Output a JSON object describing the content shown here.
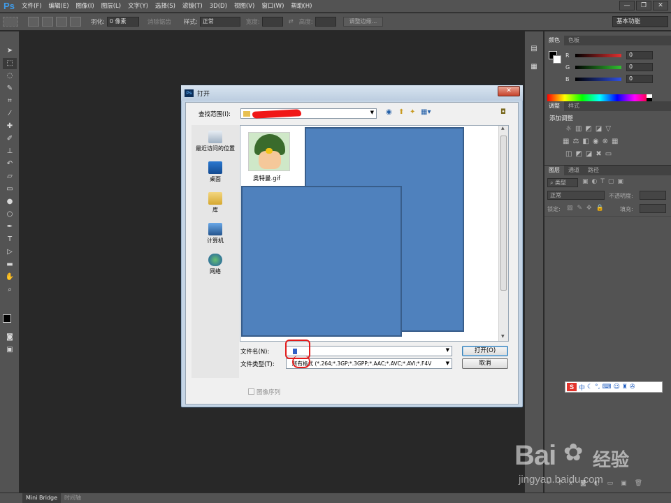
{
  "app": {
    "logo": "Ps",
    "menu": [
      "文件(F)",
      "编辑(E)",
      "图像(I)",
      "图层(L)",
      "文字(Y)",
      "选择(S)",
      "滤镜(T)",
      "3D(D)",
      "视图(V)",
      "窗口(W)",
      "帮助(H)"
    ],
    "window_controls": [
      "—",
      "❐",
      "✕"
    ]
  },
  "options": {
    "feather_label": "羽化:",
    "feather_value": "0 像素",
    "antialias_label": "消除锯齿",
    "style_label": "样式:",
    "style_value": "正常",
    "width_label": "宽度:",
    "height_label": "高度:",
    "refine_edge": "调整边缘...",
    "workspace": "基本功能"
  },
  "panels": {
    "color_tabs": [
      "颜色",
      "色板"
    ],
    "channels": [
      {
        "label": "R",
        "value": "0",
        "color": "#e03030"
      },
      {
        "label": "G",
        "value": "0",
        "color": "#30c030"
      },
      {
        "label": "B",
        "value": "0",
        "color": "#3050e0"
      }
    ],
    "adjust_tabs": [
      "调整",
      "样式"
    ],
    "adjust_title": "添加调整",
    "layers_tabs": [
      "图层",
      "通道",
      "路径"
    ],
    "layer_filter": "类型",
    "blend_mode": "正常",
    "opacity_label": "不透明度:",
    "lock_label": "锁定:",
    "fill_label": "填充:"
  },
  "bottom_tabs": [
    "Mini Bridge",
    "时间轴"
  ],
  "dialog": {
    "title": "打开",
    "look_in_label": "查找范围(I):",
    "places": [
      "最近访问的位置",
      "桌面",
      "库",
      "计算机",
      "网络"
    ],
    "file_name": "奥特曼.gif",
    "file_name_label": "文件名(N):",
    "file_type_label": "文件类型(T):",
    "file_type_value": "所有格式 (*.264;*.3GP;*.3GPP;*.AAC;*.AVC;*.AVI;*.F4V",
    "open_button": "打开(O)",
    "cancel_button": "取消",
    "image_sequence": "图像序列"
  },
  "ime": {
    "logo": "S",
    "mode": "中"
  },
  "watermark": {
    "brand": "Bai",
    "brand_suffix": "经验",
    "url": "jingyan.baidu.com"
  }
}
